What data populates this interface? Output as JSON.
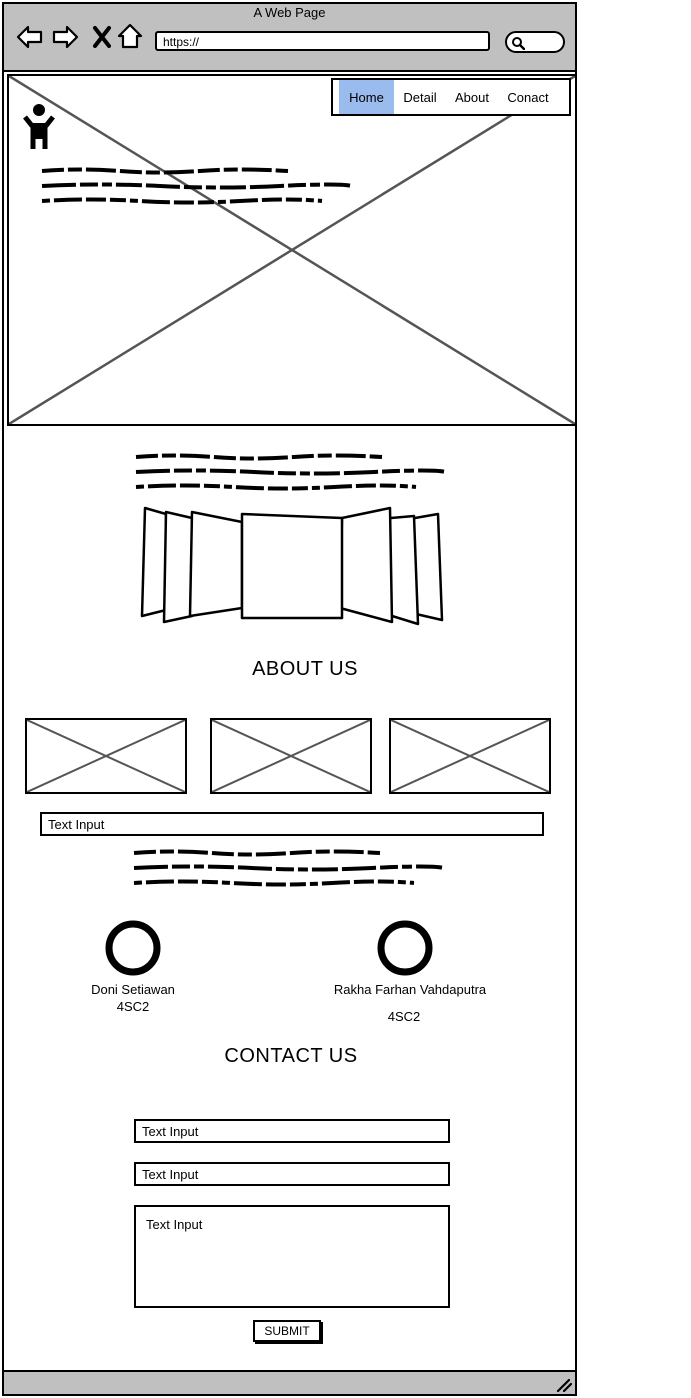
{
  "browser": {
    "title": "A Web Page",
    "url": "https://"
  },
  "nav": {
    "items": [
      {
        "label": "Home",
        "active": true
      },
      {
        "label": "Detail",
        "active": false
      },
      {
        "label": "About",
        "active": false
      },
      {
        "label": "Conact",
        "active": false
      }
    ]
  },
  "about": {
    "heading": "ABOUT US",
    "text_input": "Text Input"
  },
  "team": [
    {
      "name": "Doni Setiawan",
      "class": "4SC2"
    },
    {
      "name": "Rakha Farhan Vahdaputra",
      "class": "4SC2"
    }
  ],
  "contact": {
    "heading": "CONTACT US",
    "field1": "Text Input",
    "field2": "Text Input",
    "message": "Text Input",
    "submit_label": "SUBMIT"
  },
  "icons": {
    "back": "arrow-left-icon",
    "forward": "arrow-right-icon",
    "stop": "close-icon",
    "home": "home-icon",
    "search": "search-icon",
    "user": "user-icon",
    "resize": "resize-handle-icon"
  },
  "colors": {
    "chrome": "#c0c0c0",
    "nav_active": "#99bbee"
  }
}
